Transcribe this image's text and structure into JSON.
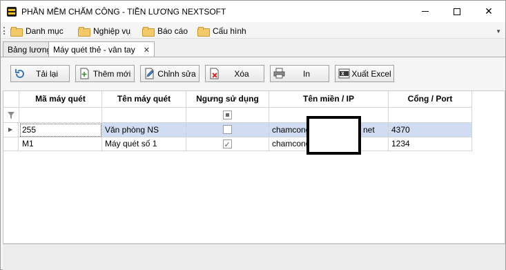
{
  "window": {
    "title": "PHẦN MỀM CHẤM CÔNG - TIỀN LƯƠNG NEXTSOFT",
    "icon": "app-logo-icon"
  },
  "menu": {
    "items": [
      {
        "label": "Danh mục",
        "icon": "folder-icon"
      },
      {
        "label": "Nghiệp vụ",
        "icon": "folder-icon"
      },
      {
        "label": "Báo cáo",
        "icon": "folder-icon"
      },
      {
        "label": "Cấu hình",
        "icon": "folder-icon"
      }
    ]
  },
  "tabs": [
    {
      "label": "Bảng lương",
      "active": false
    },
    {
      "label": "Máy quét thẻ - vân tay",
      "active": true
    }
  ],
  "toolbar": {
    "reload": "Tải lại",
    "add": "Thêm mới",
    "edit": "Chỉnh sửa",
    "delete": "Xóa",
    "print": "In",
    "export": "Xuất Excel"
  },
  "grid": {
    "columns": [
      "Mã máy quét",
      "Tên máy quét",
      "Ngưng sử dụng",
      "Tên miền / IP",
      "Cổng / Port"
    ],
    "rows": [
      {
        "code": "255",
        "name": "Văn phòng NS",
        "disabled": false,
        "domain": "chamcongn",
        "domain_tail": "net",
        "port": "4370",
        "selected": true
      },
      {
        "code": "M1",
        "name": "Máy quét số 1",
        "disabled": true,
        "domain": "chamcong.",
        "domain_tail": "",
        "port": "1234",
        "selected": false
      }
    ]
  },
  "colors": {
    "selected_row": "#d0dcf1",
    "accent": "#f5c518"
  }
}
